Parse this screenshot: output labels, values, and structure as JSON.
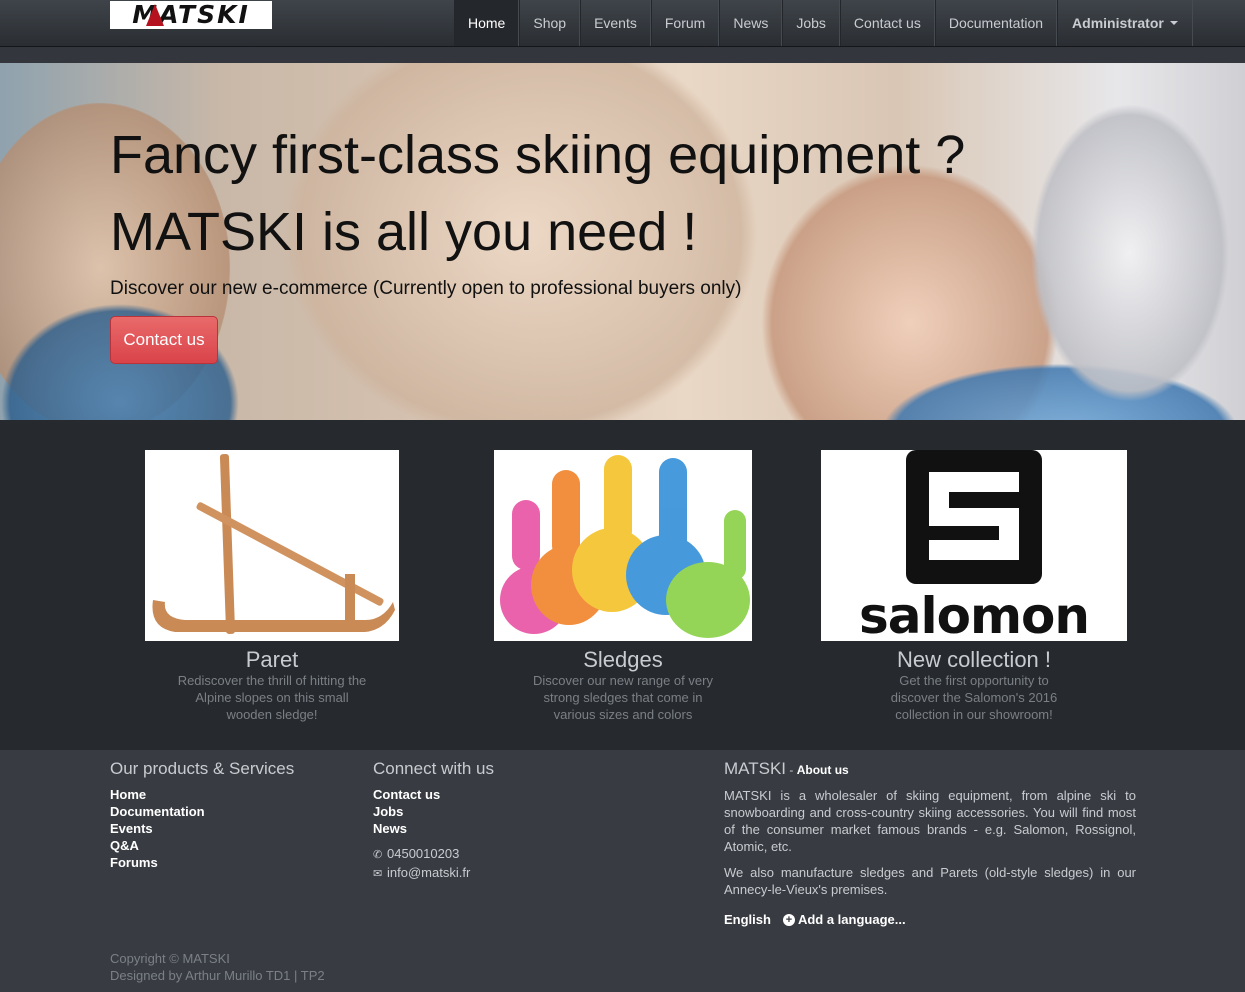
{
  "navbar": {
    "logo_text": "MATSKI",
    "items": [
      {
        "label": "Home",
        "active": true
      },
      {
        "label": "Shop"
      },
      {
        "label": "Events"
      },
      {
        "label": "Forum"
      },
      {
        "label": "News"
      },
      {
        "label": "Jobs"
      },
      {
        "label": "Contact us"
      },
      {
        "label": "Documentation"
      }
    ],
    "admin_label": "Administrator"
  },
  "hero": {
    "heading_line1": "Fancy first-class skiing equipment ?",
    "heading_line2": "MATSKI is all you need !",
    "subtext": "Discover our new e-commerce (Currently open to professional buyers only)",
    "button_label": "Contact us"
  },
  "features": [
    {
      "title": "Paret",
      "text": "Rediscover the thrill of hitting the Alpine slopes on this small wooden sledge!"
    },
    {
      "title": "Sledges",
      "text": "Discover our new range of very strong sledges that come in various sizes and colors"
    },
    {
      "title": "New collection !",
      "text": "Get the first opportunity to discover the Salomon's 2016 collection in our showroom!",
      "logo_text": "salomon"
    }
  ],
  "footer": {
    "col1": {
      "title": "Our products & Services",
      "links": [
        "Home",
        "Documentation",
        "Events",
        "Q&A",
        "Forums"
      ]
    },
    "col2": {
      "title": "Connect with us",
      "links": [
        "Contact us",
        "Jobs",
        "News"
      ],
      "phone": "0450010203",
      "email": "info@matski.fr"
    },
    "col3": {
      "title": "MATSKI",
      "title_sep": " - ",
      "title_sub": "About us",
      "paragraph1": "MATSKI is a wholesaler of skiing equipment, from alpine ski to snowboarding and cross-country skiing accessories. You will find most of the consumer market famous brands - e.g. Salomon, Rossignol, Atomic, etc.",
      "paragraph2": "We also manufacture sledges and Parets (old-style sledges) in our Annecy-le-Vieux's premises.",
      "language": "English",
      "add_language": "Add a language..."
    },
    "copyright": "Copyright © MATSKI",
    "designed_by": "Designed by Arthur Murillo TD1 | TP2"
  }
}
